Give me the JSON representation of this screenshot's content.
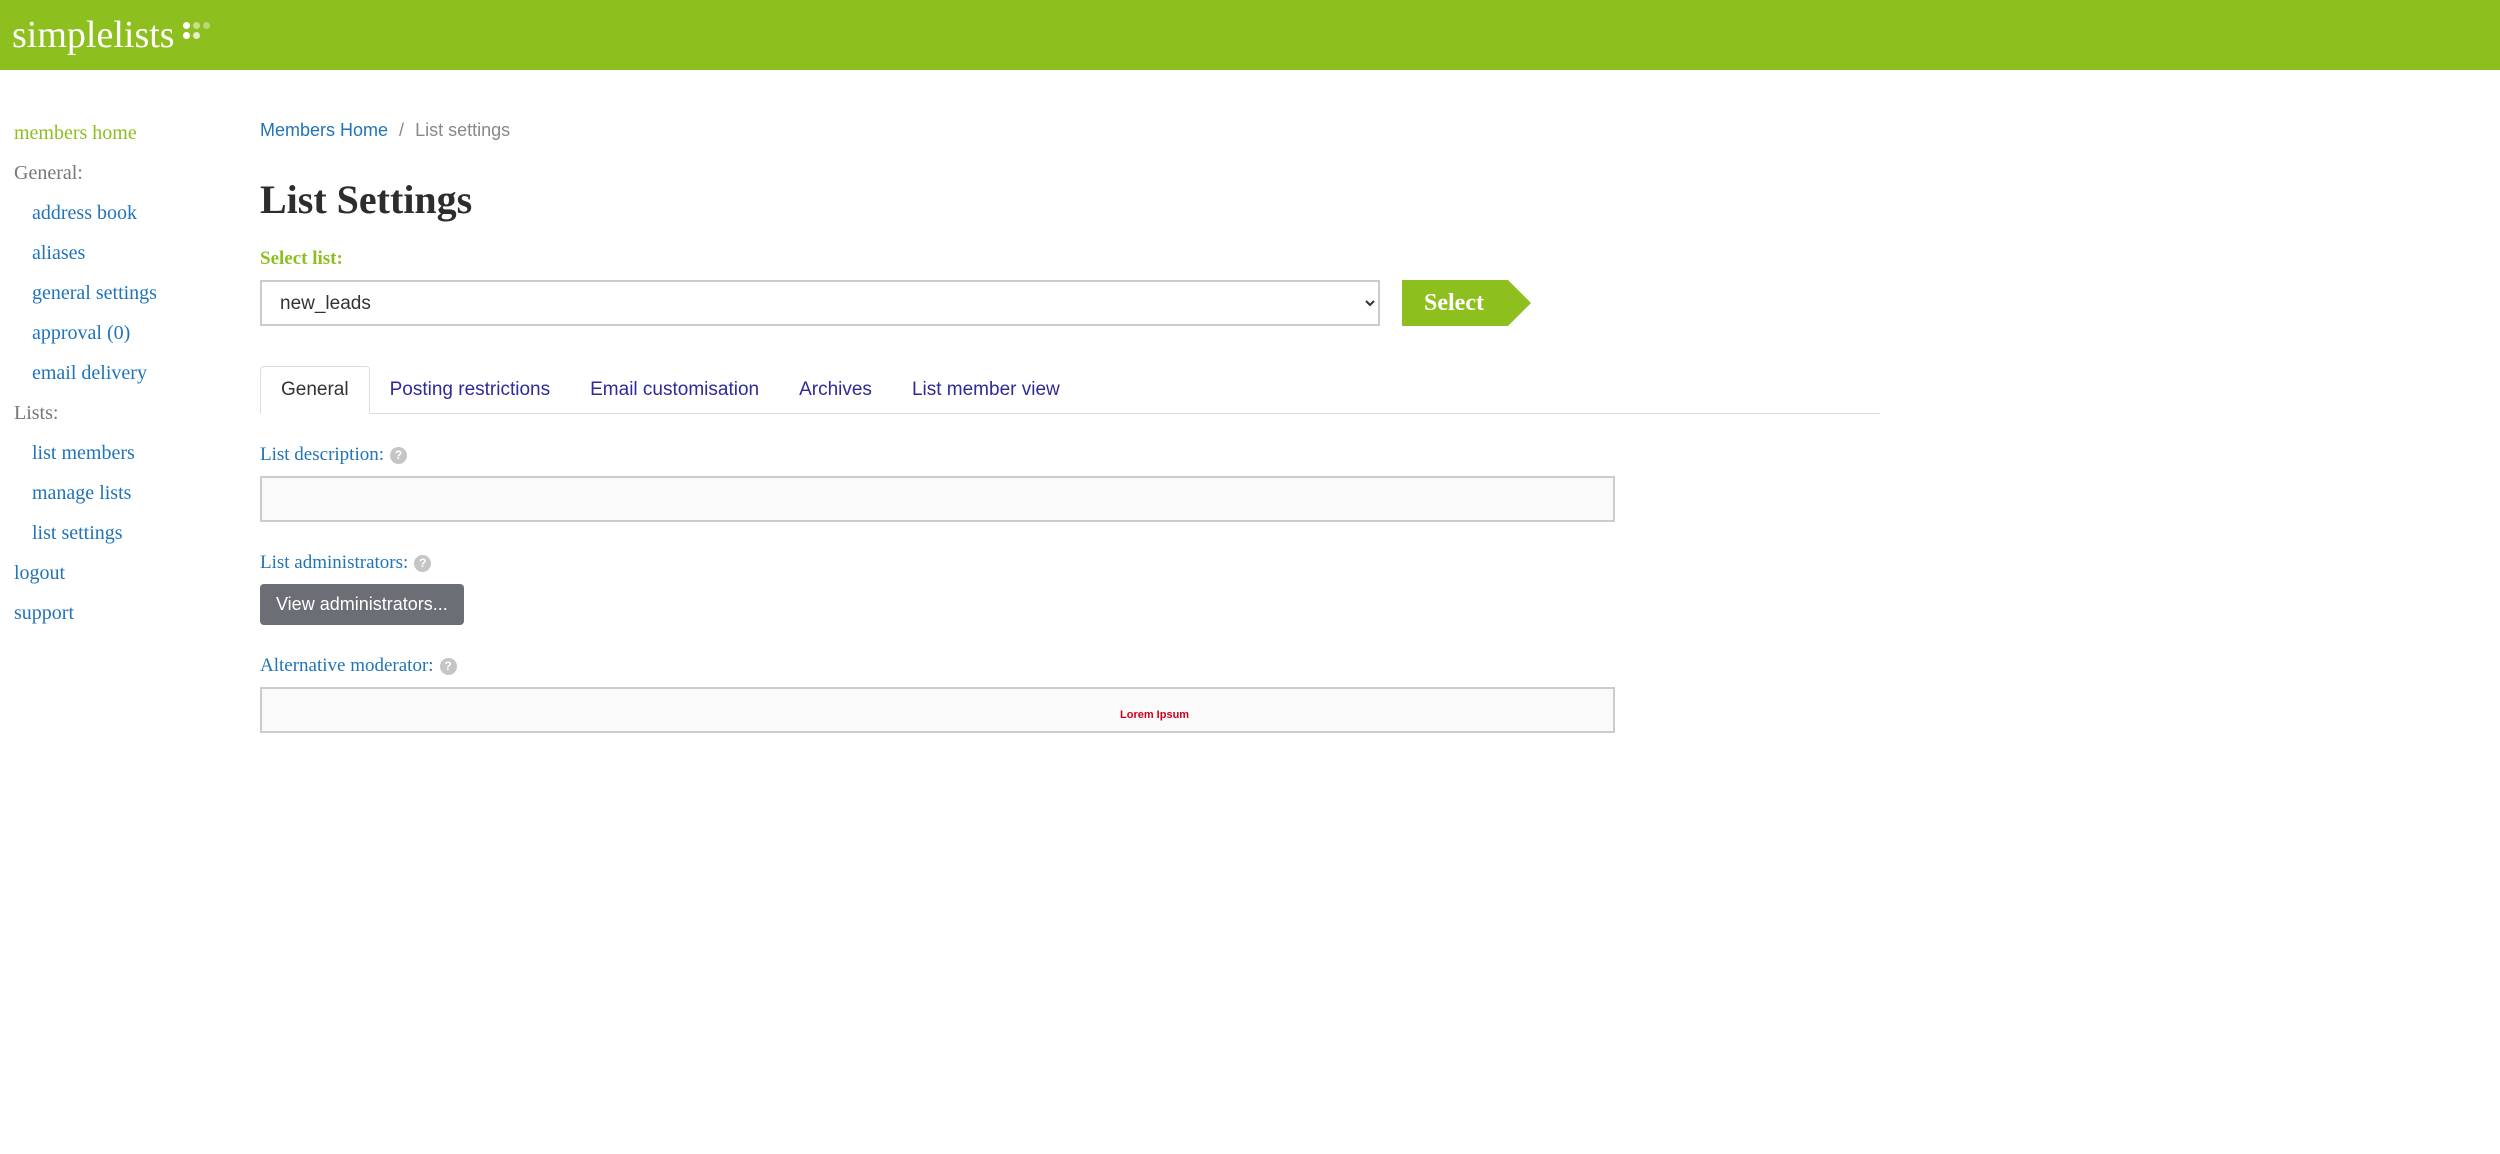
{
  "brand": "simplelists",
  "sidebar": {
    "home": "members home",
    "general_label": "General:",
    "general_items": [
      "address book",
      "aliases",
      "general settings",
      "approval (0)",
      "email delivery"
    ],
    "lists_label": "Lists:",
    "lists_items": [
      "list members",
      "manage lists",
      "list settings"
    ],
    "logout": "logout",
    "support": "support"
  },
  "breadcrumb": {
    "home": "Members Home",
    "current": "List settings"
  },
  "page_title": "List Settings",
  "select_list": {
    "label": "Select list:",
    "value": "new_leads",
    "button": "Select"
  },
  "tabs": [
    "General",
    "Posting restrictions",
    "Email customisation",
    "Archives",
    "List member view"
  ],
  "active_tab": 0,
  "form": {
    "description_label": "List description:",
    "description_value": "",
    "admins_label": "List administrators:",
    "view_admins_button": "View administrators...",
    "alt_mod_label": "Alternative moderator:",
    "alt_mod_value": ""
  },
  "watermark": "Lorem Ipsum"
}
